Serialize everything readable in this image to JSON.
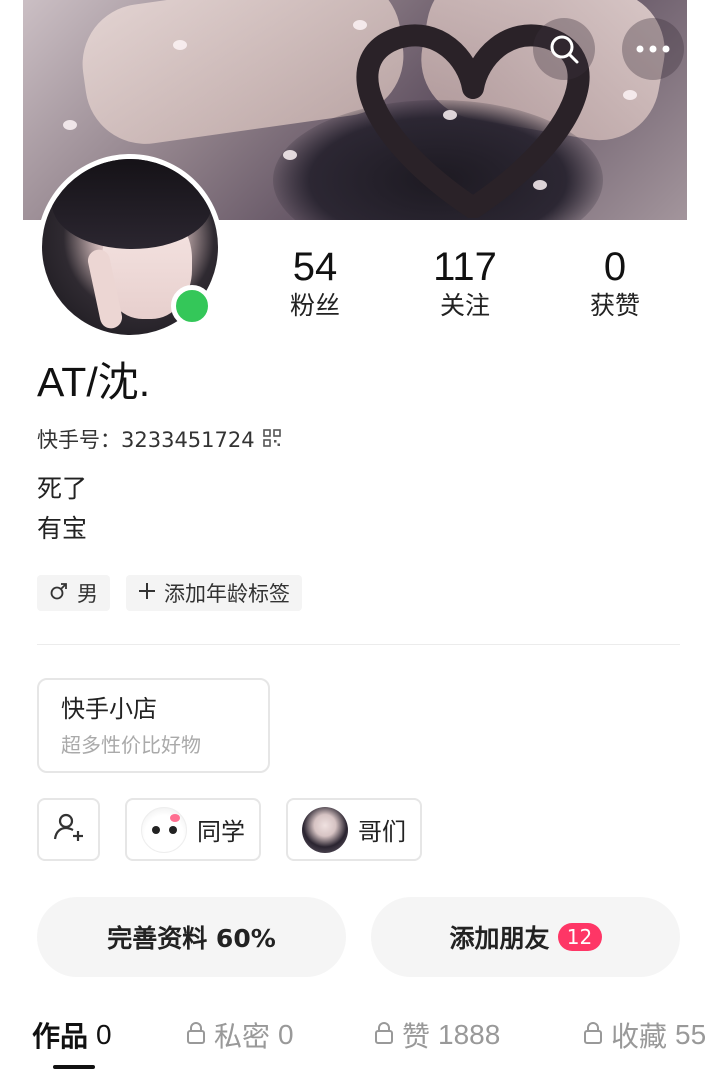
{
  "profile": {
    "name": "AT/沈.",
    "id_label": "快手号：3233451724",
    "bio_line1": "死了",
    "bio_line2": "有宝",
    "online": true
  },
  "stats": [
    {
      "value": "54",
      "label": "粉丝"
    },
    {
      "value": "117",
      "label": "关注"
    },
    {
      "value": "0",
      "label": "获赞"
    }
  ],
  "tags": {
    "gender": "男",
    "add_age": "添加年龄标签"
  },
  "shop": {
    "title": "快手小店",
    "subtitle": "超多性价比好物"
  },
  "chips": {
    "classmate": "同学",
    "bros": "哥们"
  },
  "actions": {
    "complete_profile": "完善资料 60%",
    "add_friends": "添加朋友",
    "add_friends_badge": "12"
  },
  "tabs": [
    {
      "label": "作品",
      "count": "0"
    },
    {
      "label": "私密",
      "count": "0"
    },
    {
      "label": "赞",
      "count": "1888"
    },
    {
      "label": "收藏",
      "count": "55"
    }
  ],
  "colors": {
    "online": "#34c759",
    "badge": "#fe3666"
  }
}
